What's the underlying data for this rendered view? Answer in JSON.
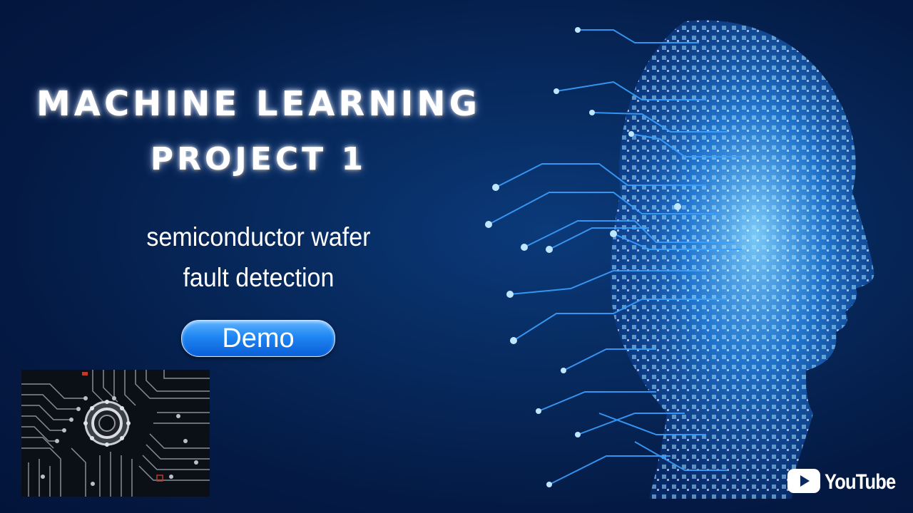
{
  "title_line1": "MACHINE LEARNING",
  "title_line2": "PROJECT 1",
  "subtitle_line1": "semiconductor wafer",
  "subtitle_line2": "fault detection",
  "demo_button": "Demo",
  "brand_label": "YouTube",
  "colors": {
    "background": "#062a5e",
    "accent": "#1f86f2",
    "circuit_glow": "#3aa0ff"
  },
  "icons": [
    "youtube-play-icon"
  ]
}
